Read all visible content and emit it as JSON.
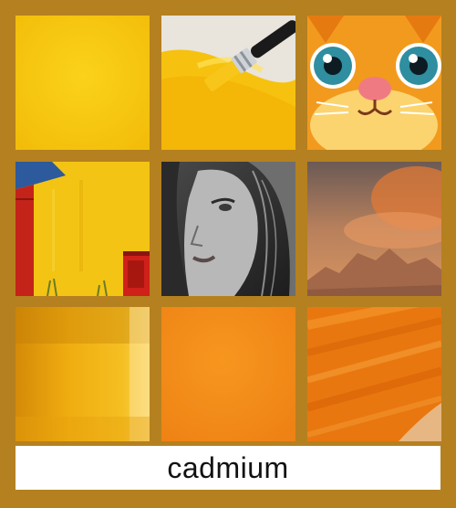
{
  "caption": {
    "text": "cadmium"
  },
  "colors": {
    "frame": "#b5801f",
    "caption_bg": "#ffffff",
    "caption_text": "#111111"
  },
  "tiles": [
    {
      "name": "plain-yellow-swatch",
      "row": 1,
      "col": 1
    },
    {
      "name": "paintbrush-yellow-paint",
      "row": 1,
      "col": 2
    },
    {
      "name": "cartoon-cat-face",
      "row": 1,
      "col": 3
    },
    {
      "name": "yellow-wall-red-barn",
      "row": 2,
      "col": 1
    },
    {
      "name": "monochrome-woman-portrait",
      "row": 2,
      "col": 2
    },
    {
      "name": "orange-desert-sky",
      "row": 2,
      "col": 3
    },
    {
      "name": "amber-gradient-swatch",
      "row": 3,
      "col": 1
    },
    {
      "name": "orange-swatch",
      "row": 3,
      "col": 2
    },
    {
      "name": "orange-brushstroke-texture",
      "row": 3,
      "col": 3
    }
  ]
}
